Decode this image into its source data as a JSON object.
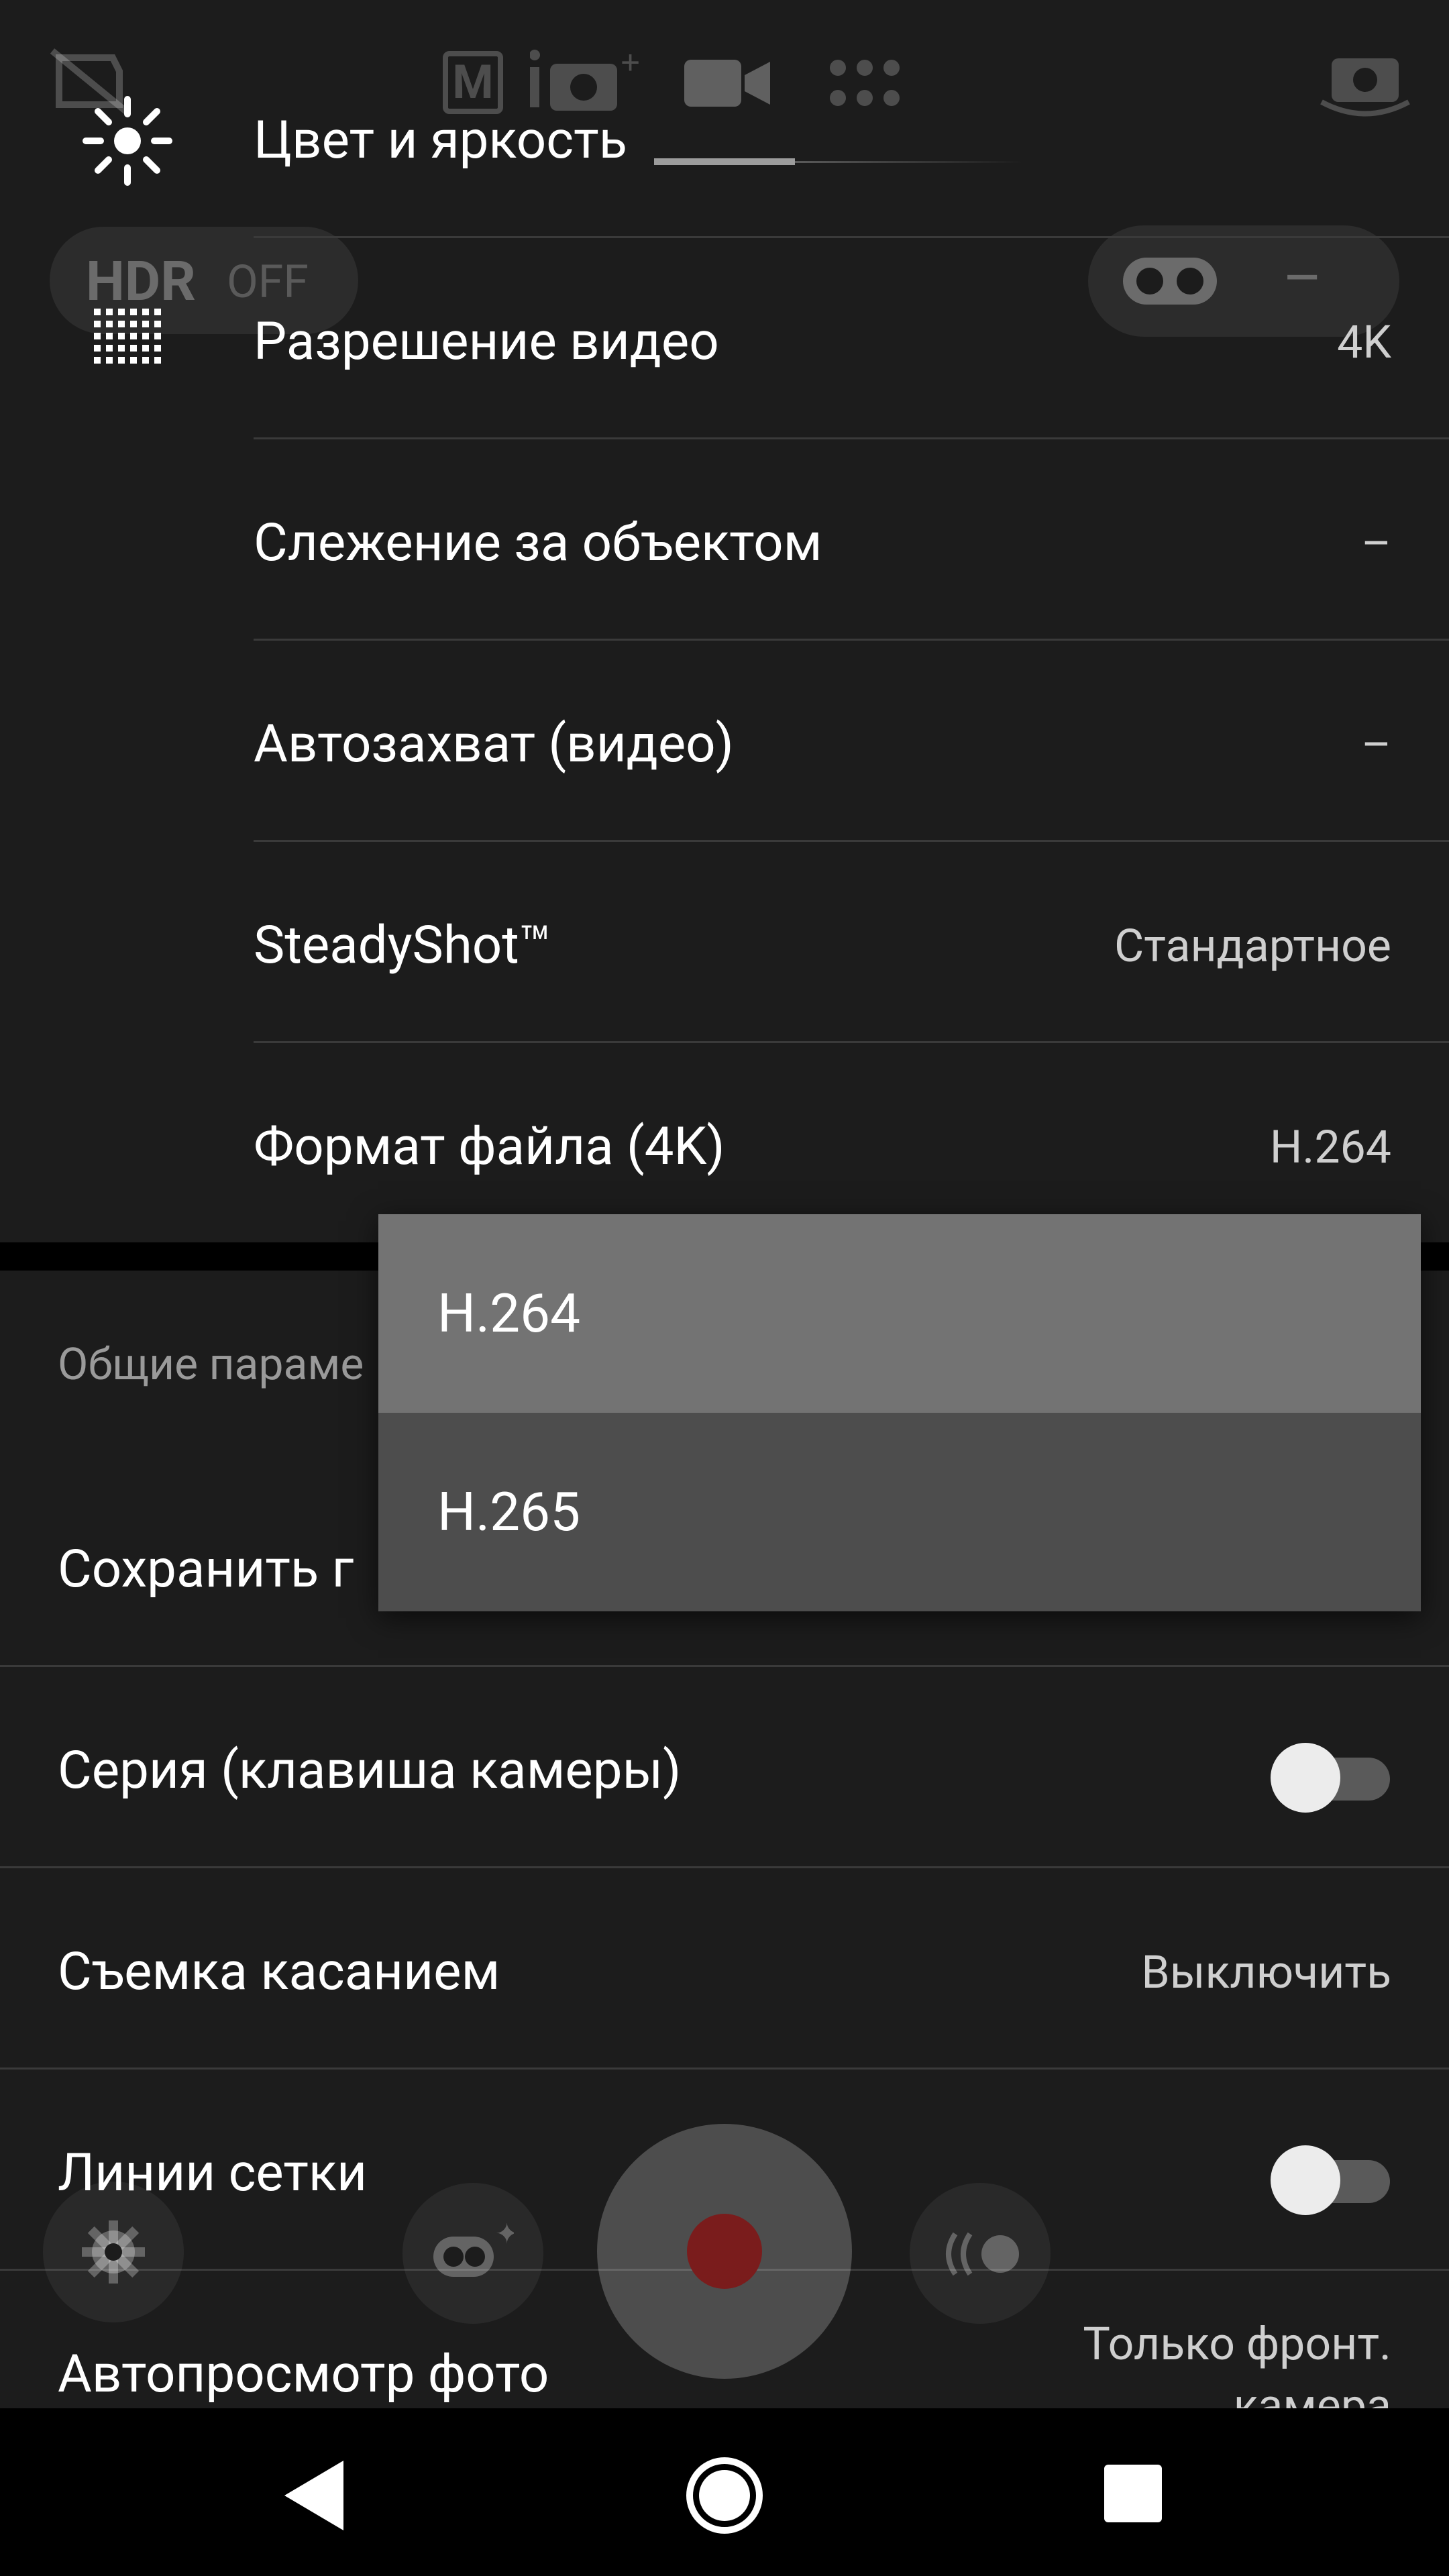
{
  "camera_background": {
    "hdr_label": "HDR",
    "hdr_state": "OFF",
    "mode_letter": "M",
    "right_pill_value": "–"
  },
  "settings_top": [
    {
      "label": "Цвет и яркость",
      "value": ""
    },
    {
      "label": "Разрешение видео",
      "value": "4K"
    },
    {
      "label": "Слежение за объектом",
      "value": "–"
    },
    {
      "label": "Автозахват (видео)",
      "value": "–"
    },
    {
      "label": "SteadyShot™",
      "value": "Стандартное"
    },
    {
      "label": "Формат файла (4K)",
      "value": "H.264"
    }
  ],
  "section_general": {
    "title": "Общие параме"
  },
  "settings_general": [
    {
      "label": "Сохранить г",
      "value": ""
    },
    {
      "label": "Серия (клавиша камеры)",
      "toggle_on": false
    },
    {
      "label": "Съемка касанием",
      "value": "Выключить"
    },
    {
      "label": "Линии сетки",
      "toggle_on": false
    },
    {
      "label": "Автопросмотр фото",
      "value_line1": "Только фронт.",
      "value_line2": "камера"
    }
  ],
  "dropdown": {
    "options": [
      "H.264",
      "H.265"
    ],
    "selected_index": 0
  },
  "colors": {
    "background": "#1c1c1c",
    "dropdown_bg": "#4d4d4d",
    "dropdown_selected": "#737373",
    "record_dot": "#8a1f1f"
  }
}
